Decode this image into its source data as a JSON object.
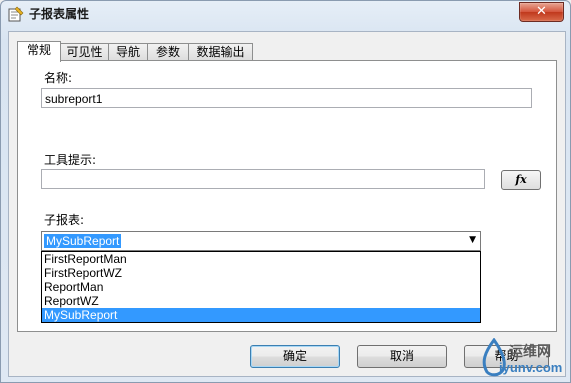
{
  "window": {
    "title": "子报表属性",
    "close_symbol": "✕"
  },
  "tabs": [
    {
      "label": "常规",
      "active": true
    },
    {
      "label": "可见性",
      "active": false
    },
    {
      "label": "导航",
      "active": false
    },
    {
      "label": "参数",
      "active": false
    },
    {
      "label": "数据输出",
      "active": false
    }
  ],
  "general": {
    "name_label": "名称:",
    "name_value": "subreport1",
    "tooltip_label": "工具提示:",
    "tooltip_value": "",
    "fx_label": "fx",
    "subreport_label": "子报表:",
    "subreport_selected": "MySubReport",
    "subreport_options": [
      "FirstReportMan",
      "FirstReportWZ",
      "ReportMan",
      "ReportWZ",
      "MySubReport"
    ]
  },
  "buttons": {
    "ok": "确定",
    "cancel": "取消",
    "help": "帮助"
  },
  "watermark": {
    "line1": "运维网",
    "line2": "iyunv.com"
  }
}
